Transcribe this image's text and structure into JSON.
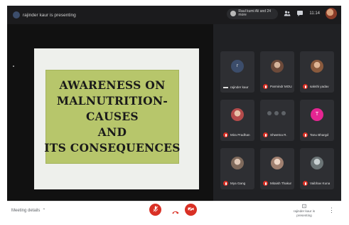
{
  "topbar": {
    "presenter_text": "rajinder kaur is presenting",
    "notice_text": "Raul kumi Ali and 24 more",
    "time": "11:14"
  },
  "slide": {
    "lines": [
      "AWARENESS ON",
      "MALNUTRITION-",
      "CAUSES",
      "AND",
      "ITS CONSEQUENCES"
    ]
  },
  "participants": [
    {
      "name": "rajinder kaur",
      "initial": "r",
      "muted": false,
      "color": "#3c4d6b"
    },
    {
      "name": "Parmindr MOUAT",
      "initial": "",
      "muted": true,
      "color": "#8b6a55"
    },
    {
      "name": "sakshi yadav",
      "initial": "",
      "muted": true,
      "color": "#a8734f"
    },
    {
      "name": "Mira Pradhan",
      "initial": "",
      "muted": true,
      "color": "#c26a6a"
    },
    {
      "name": "Shwetna R.",
      "initial": "",
      "muted": true,
      "color": "#5f6368"
    },
    {
      "name": "Tanu Bhargd",
      "initial": "T",
      "muted": true,
      "color": "#e52592"
    },
    {
      "name": "Mya Gang",
      "initial": "",
      "muted": true,
      "color": "#b7a89a"
    },
    {
      "name": "Mitaish Thakur",
      "initial": "",
      "muted": true,
      "color": "#c8b3a5"
    },
    {
      "name": "Vaibhav Kuna",
      "initial": "",
      "muted": true,
      "color": "#9da6a8"
    }
  ],
  "bottombar": {
    "meeting_details": "Meeting details",
    "present_label": "rajinder kaur is presenting"
  },
  "colors": {
    "accent_red": "#d93025",
    "slide_box": "#b7c66b"
  },
  "icons": [
    "people-icon",
    "chat-icon",
    "mic-off-icon",
    "call-end-icon",
    "camera-off-icon",
    "present-icon",
    "more-vert-icon"
  ]
}
